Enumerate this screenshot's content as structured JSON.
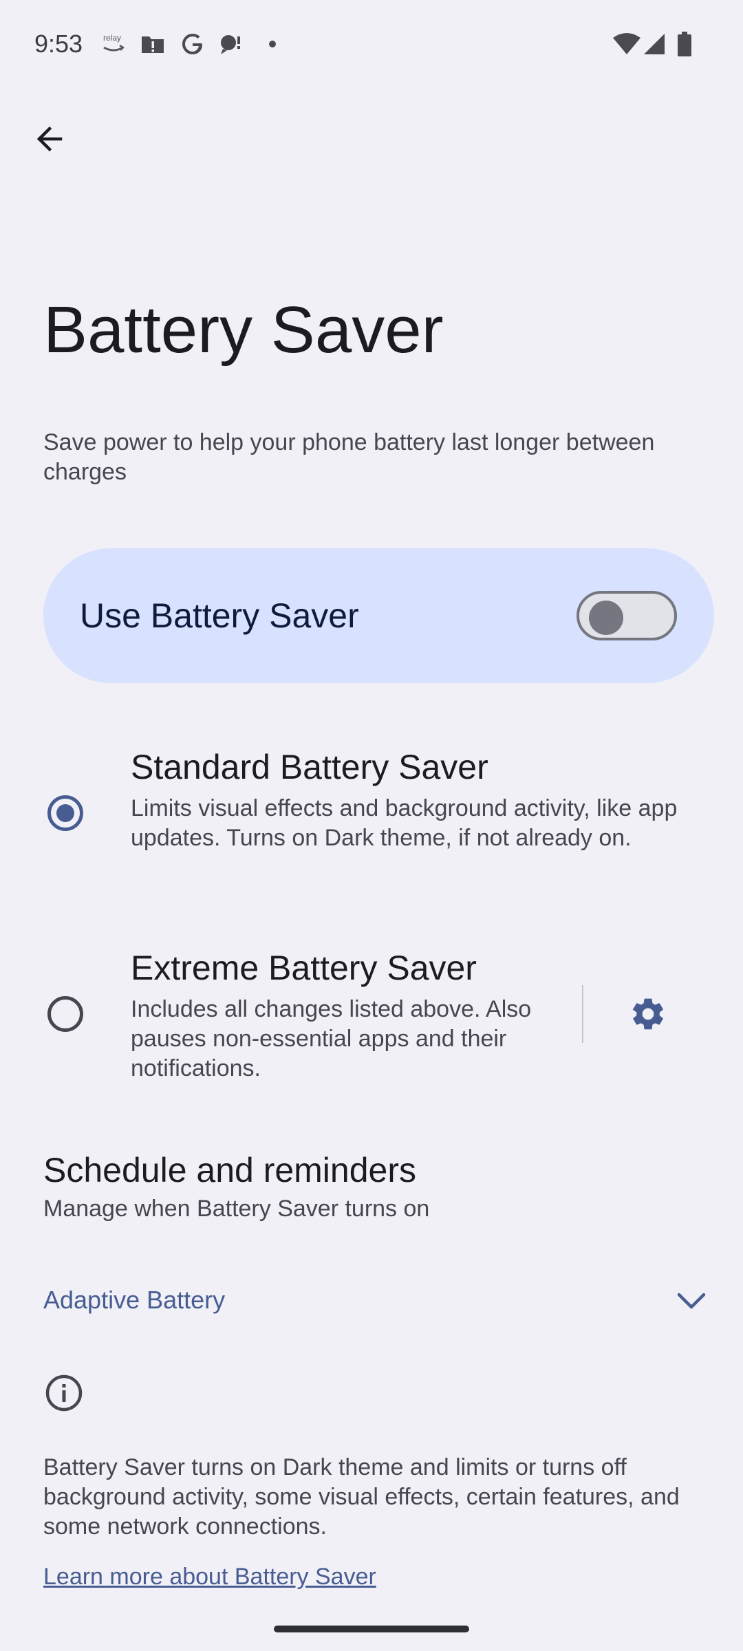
{
  "status_bar": {
    "time": "9:53",
    "icons_left": [
      "relay-icon",
      "alert-folder-icon",
      "google-icon",
      "chat-bubble-icon",
      "dot-icon"
    ],
    "icons_right": [
      "wifi-icon",
      "signal-icon",
      "battery-icon"
    ],
    "relay_text": "relay"
  },
  "header": {
    "back_label": "Back"
  },
  "page": {
    "title": "Battery Saver",
    "description": "Save power to help your phone battery last longer between charges"
  },
  "main_toggle": {
    "label": "Use Battery Saver",
    "checked": false
  },
  "options": [
    {
      "title": "Standard Battery Saver",
      "summary": "Limits visual effects and background activity, like app updates. Turns on Dark theme, if not already on.",
      "selected": true
    },
    {
      "title": "Extreme Battery Saver",
      "summary": "Includes all changes listed above. Also pauses non-essential apps and their notifications.",
      "selected": false,
      "has_settings": true
    }
  ],
  "schedule": {
    "title": "Schedule and reminders",
    "summary": "Manage when Battery Saver turns on"
  },
  "adaptive": {
    "label": "Adaptive Battery"
  },
  "footer": {
    "text": "Battery Saver turns on Dark theme and limits or turns off background activity, some visual effects, certain features, and some network connections.",
    "link": "Learn more about Battery Saver"
  },
  "colors": {
    "background": "#f1f0f7",
    "card": "#d8e2ff",
    "accent": "#475d92",
    "text_primary": "#1b1b21",
    "text_secondary": "#45464f"
  }
}
